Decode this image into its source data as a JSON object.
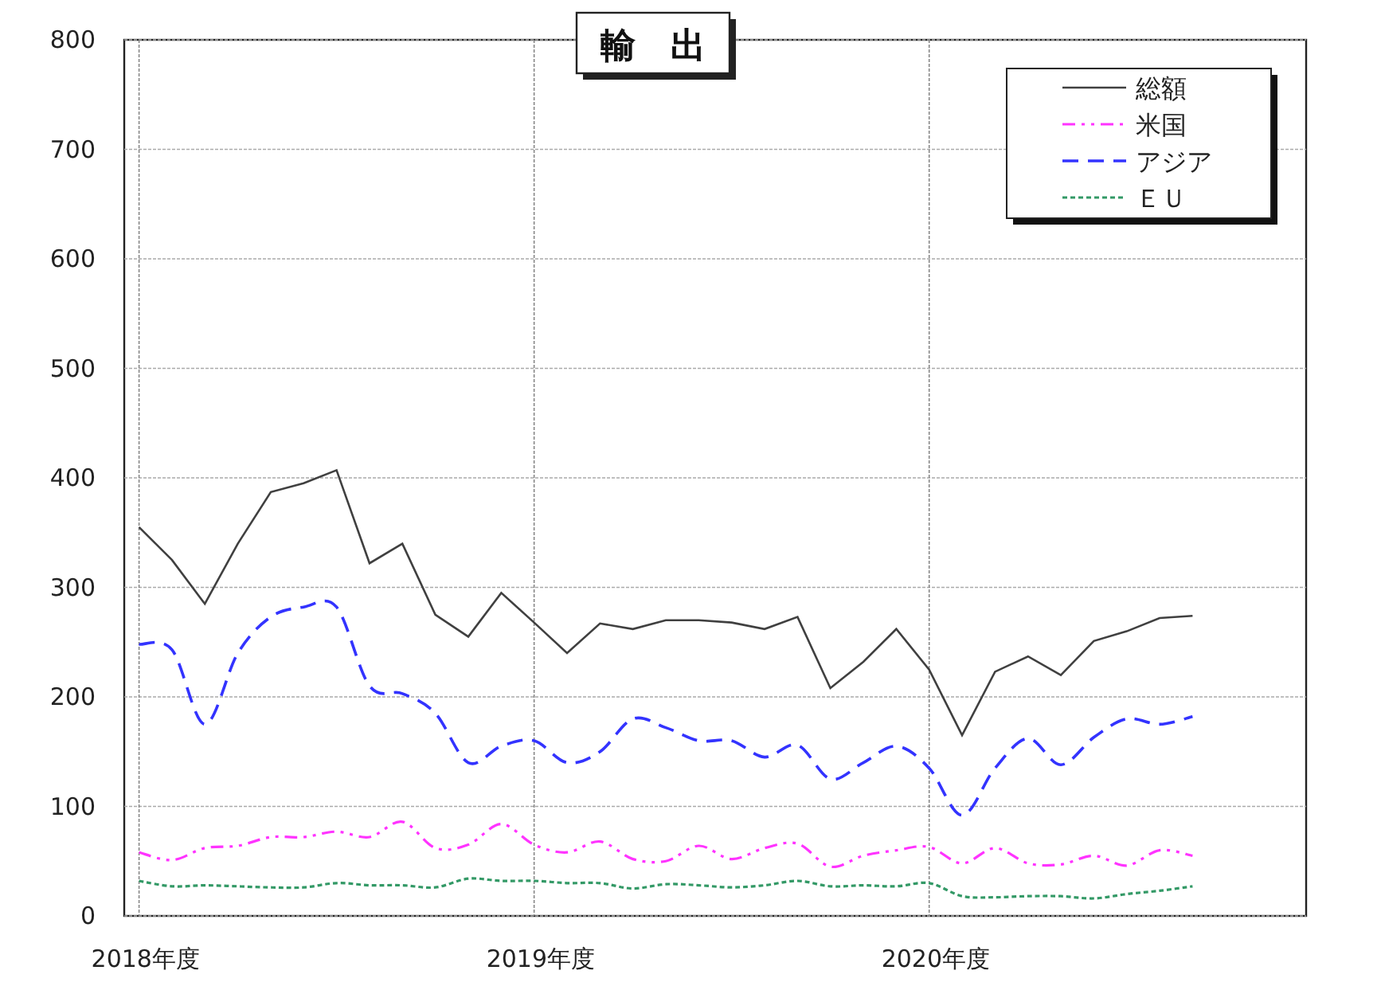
{
  "chart": {
    "title": "輸　出",
    "chart_data": {
      "type": "line",
      "categories": [
        "2018年度",
        null,
        null,
        null,
        null,
        null,
        null,
        null,
        null,
        null,
        null,
        null,
        "2019年度",
        null,
        null,
        null,
        null,
        null,
        null,
        null,
        null,
        null,
        null,
        null,
        "2020年度",
        null,
        null,
        null,
        null,
        null,
        null,
        null,
        null
      ],
      "ylim": [
        0,
        800
      ],
      "grid": true,
      "legend": true,
      "yticks": [
        0,
        100,
        200,
        300,
        400,
        500,
        600,
        700,
        800
      ],
      "series": [
        {
          "name": "総額",
          "color": "#404040",
          "line_style": "solid",
          "values": [
            355,
            325,
            285,
            340,
            387,
            395,
            407,
            322,
            340,
            275,
            255,
            295,
            268,
            240,
            267,
            262,
            270,
            270,
            268,
            262,
            273,
            208,
            232,
            262,
            225,
            165,
            223,
            237,
            220,
            251,
            260,
            272,
            274
          ]
        },
        {
          "name": "米国",
          "color": "#ff33ff",
          "line_style": "dashdotdot",
          "values": [
            58,
            51,
            62,
            64,
            72,
            72,
            77,
            72,
            86,
            62,
            65,
            84,
            65,
            58,
            68,
            52,
            50,
            64,
            52,
            62,
            66,
            45,
            55,
            60,
            63,
            48,
            62,
            48,
            47,
            55,
            46,
            60,
            55
          ]
        },
        {
          "name": "アジア",
          "color": "#3333ff",
          "line_style": "dashed",
          "values": [
            248,
            243,
            175,
            240,
            273,
            282,
            282,
            210,
            203,
            185,
            140,
            155,
            160,
            140,
            150,
            180,
            172,
            160,
            160,
            145,
            156,
            125,
            140,
            155,
            135,
            92,
            135,
            162,
            138,
            163,
            180,
            175,
            182
          ]
        },
        {
          "name": "ＥＵ",
          "color": "#339966",
          "line_style": "dotted",
          "values": [
            32,
            27,
            28,
            27,
            26,
            26,
            30,
            28,
            28,
            26,
            34,
            32,
            32,
            30,
            30,
            25,
            29,
            28,
            26,
            28,
            32,
            27,
            28,
            27,
            30,
            18,
            17,
            18,
            18,
            16,
            20,
            23,
            27
          ]
        }
      ]
    }
  }
}
